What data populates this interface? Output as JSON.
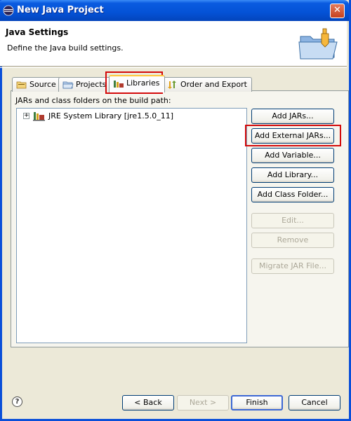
{
  "window": {
    "title": "New Java Project",
    "close_glyph": "✕"
  },
  "header": {
    "title": "Java Settings",
    "description": "Define the Java build settings."
  },
  "tabs": [
    {
      "label": "Source",
      "icon": "source-folder-icon",
      "active": false
    },
    {
      "label": "Projects",
      "icon": "projects-folder-icon",
      "active": false
    },
    {
      "label": "Libraries",
      "icon": "libraries-icon",
      "active": true
    },
    {
      "label": "Order and Export",
      "icon": "order-export-icon",
      "active": false
    }
  ],
  "libraries": {
    "caption": "JARs and class folders on the build path:",
    "items": [
      {
        "label": "JRE System Library [jre1.5.0_11]",
        "expand_glyph": "+"
      }
    ]
  },
  "side_buttons": {
    "add_jars": "Add JARs...",
    "add_external_jars": "Add External JARs...",
    "add_variable": "Add Variable...",
    "add_library": "Add Library...",
    "add_class_folder": "Add Class Folder...",
    "edit": "Edit...",
    "remove": "Remove",
    "migrate_jar": "Migrate JAR File..."
  },
  "footer": {
    "help_glyph": "?",
    "back": "< Back",
    "next": "Next >",
    "finish": "Finish",
    "cancel": "Cancel"
  },
  "colors": {
    "highlight": "#D40A0A",
    "titlebar": "#0452D6",
    "dialog_bg": "#ECE9D8"
  }
}
